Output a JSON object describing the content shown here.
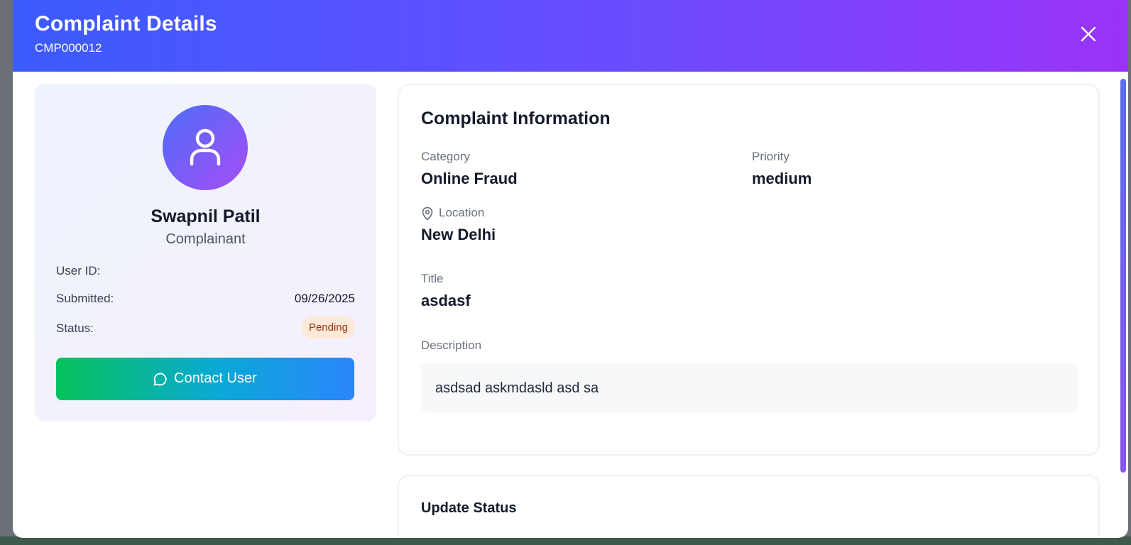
{
  "modal": {
    "title": "Complaint Details",
    "complaint_id": "CMP000012"
  },
  "profile": {
    "name": "Swapnil Patil",
    "role": "Complainant",
    "user_id_label": "User ID:",
    "user_id_value": "",
    "submitted_label": "Submitted:",
    "submitted_value": "09/26/2025",
    "status_label": "Status:",
    "status_value": "Pending",
    "contact_button_label": "Contact User"
  },
  "complaint_info": {
    "section_title": "Complaint Information",
    "category_label": "Category",
    "category_value": "Online Fraud",
    "priority_label": "Priority",
    "priority_value": "medium",
    "location_label": "Location",
    "location_value": "New Delhi",
    "title_label": "Title",
    "title_value": "asdasf",
    "description_label": "Description",
    "description_value": "asdsad askmdasld asd sa"
  },
  "update_status": {
    "section_title": "Update Status"
  },
  "icons": {
    "close": "close-icon",
    "avatar": "user-icon",
    "contact": "message-circle-icon",
    "location": "map-pin-icon"
  },
  "colors": {
    "header_gradient_start": "#3b5bfd",
    "header_gradient_end": "#9a32f7",
    "contact_gradient_start": "#05c35a",
    "contact_gradient_end": "#2a86fb",
    "status_badge_bg": "#fde9d7",
    "status_badge_text": "#9a3412"
  }
}
